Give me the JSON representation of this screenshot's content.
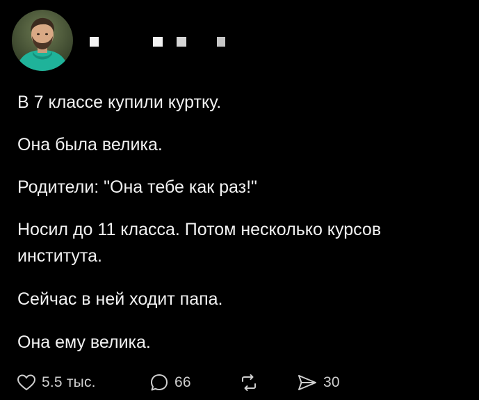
{
  "post": {
    "author": {
      "avatar_icon": "user-avatar-photo",
      "name_redacted": true
    },
    "paragraphs": [
      "В 7 классе купили куртку.",
      "Она была велика.",
      "Родители: \"Она тебе как раз!\"",
      "Носил до 11 класса. Потом несколько курсов института.",
      "Сейчас в ней ходит папа.",
      "Она ему велика."
    ],
    "actions": {
      "like": {
        "icon": "heart-icon",
        "count": "5.5 тыс."
      },
      "comment": {
        "icon": "comment-bubble-icon",
        "count": "66"
      },
      "repost": {
        "icon": "repost-icon",
        "count": ""
      },
      "share": {
        "icon": "send-icon",
        "count": "30"
      }
    }
  },
  "colors": {
    "background": "#000000",
    "text": "#f1f1f1",
    "action_text": "#cfcfcf",
    "avatar_hoodie": "#1fb39a"
  }
}
